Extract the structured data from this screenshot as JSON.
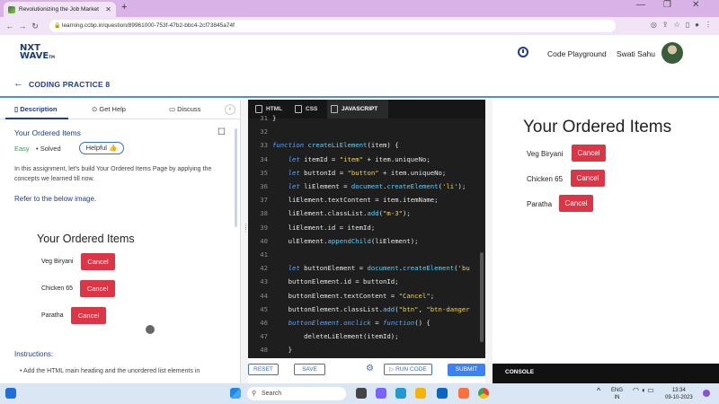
{
  "browser": {
    "tab_title": "Revolutionizing the Job Market",
    "url": "learning.ccbp.in/question/89961000-753f-47b2-bbc4-2cf73845a74f"
  },
  "header": {
    "logo_line1": "NXT",
    "logo_line2": "WAVE",
    "logo_tm": "TM",
    "code_playground": "Code Playground",
    "user_name": "Swati Sahu"
  },
  "practice": {
    "title": "CODING PRACTICE 8"
  },
  "left_panel": {
    "tabs": [
      "Description",
      "Get Help",
      "Discuss"
    ],
    "question_title": "Your Ordered Items",
    "difficulty": "Easy",
    "status": "Solved",
    "helpful_label": "Helpful",
    "description": "In this assignment, let's build Your Ordered Items Page by applying the concepts we learned till now.",
    "refer_text": "Refer to the below image.",
    "preview": {
      "title": "Your Ordered Items",
      "items": [
        {
          "name": "Veg Biryani",
          "button": "Cancel"
        },
        {
          "name": "Chicken 65",
          "button": "Cancel"
        },
        {
          "name": "Paratha",
          "button": "Cancel"
        }
      ]
    },
    "instructions_heading": "Instructions:",
    "instruction_1": "Add the HTML main heading and the unordered list elements in"
  },
  "editor": {
    "tabs": [
      "HTML",
      "CSS",
      "JAVASCRIPT"
    ],
    "active_tab": "JAVASCRIPT",
    "first_line_number": 31,
    "lines": [
      [
        {
          "t": "}"
        }
      ],
      [],
      [
        {
          "t": "function ",
          "c": "kw"
        },
        {
          "t": "createLiElement",
          "c": "fn"
        },
        {
          "t": "(item) {"
        }
      ],
      [
        {
          "t": "    let ",
          "c": "kw"
        },
        {
          "t": "itemId = "
        },
        {
          "t": "\"item\"",
          "c": "str"
        },
        {
          "t": " + item.uniqueNo;"
        }
      ],
      [
        {
          "t": "    let ",
          "c": "kw"
        },
        {
          "t": "buttonId = "
        },
        {
          "t": "\"button\"",
          "c": "str"
        },
        {
          "t": " + item.uniqueNo;"
        }
      ],
      [
        {
          "t": "    let ",
          "c": "kw"
        },
        {
          "t": "liElement = "
        },
        {
          "t": "document",
          "c": "fn"
        },
        {
          "t": "."
        },
        {
          "t": "createElement",
          "c": "fn"
        },
        {
          "t": "("
        },
        {
          "t": "'li'",
          "c": "str"
        },
        {
          "t": ");"
        }
      ],
      [
        {
          "t": "    liElement.textContent = item.itemName;"
        }
      ],
      [
        {
          "t": "    liElement.classList."
        },
        {
          "t": "add",
          "c": "fn"
        },
        {
          "t": "("
        },
        {
          "t": "\"m-3\"",
          "c": "str"
        },
        {
          "t": ");"
        }
      ],
      [
        {
          "t": "    liElement.id = itemId;"
        }
      ],
      [
        {
          "t": "    ulElement."
        },
        {
          "t": "appendChild",
          "c": "fn"
        },
        {
          "t": "(liElement);"
        }
      ],
      [],
      [
        {
          "t": "    let ",
          "c": "kw"
        },
        {
          "t": "buttonElement = "
        },
        {
          "t": "document",
          "c": "fn"
        },
        {
          "t": "."
        },
        {
          "t": "createElement",
          "c": "fn"
        },
        {
          "t": "("
        },
        {
          "t": "'bu",
          "c": "str"
        }
      ],
      [
        {
          "t": "    buttonElement.id = buttonId;"
        }
      ],
      [
        {
          "t": "    buttonElement.textContent = "
        },
        {
          "t": "\"Cancel\"",
          "c": "str"
        },
        {
          "t": ";"
        }
      ],
      [
        {
          "t": "    buttonElement.classList."
        },
        {
          "t": "add",
          "c": "fn"
        },
        {
          "t": "("
        },
        {
          "t": "\"btn\"",
          "c": "str"
        },
        {
          "t": ", "
        },
        {
          "t": "\"btn-danger",
          "c": "str"
        }
      ],
      [
        {
          "t": "    buttonElement.",
          "c": "kw"
        },
        {
          "t": "onclick",
          "c": "kw"
        },
        {
          "t": " = "
        },
        {
          "t": "function",
          "c": "kw"
        },
        {
          "t": "() {"
        }
      ],
      [
        {
          "t": "        deleteLiElement(itemId);"
        }
      ],
      [
        {
          "t": "    }"
        }
      ]
    ],
    "reset_label": "RESET",
    "save_label": "SAVE",
    "run_label": "RUN CODE",
    "submit_label": "SUBMIT"
  },
  "output": {
    "title": "Your Ordered Items",
    "items": [
      {
        "name": "Veg Biryani",
        "button": "Cancel"
      },
      {
        "name": "Chicken 65",
        "button": "Cancel"
      },
      {
        "name": "Paratha",
        "button": "Cancel"
      }
    ],
    "console_label": "CONSOLE"
  },
  "taskbar": {
    "search_placeholder": "Search",
    "lang_line1": "ENG",
    "lang_line2": "IN",
    "time": "13:34",
    "date": "09-10-2023"
  },
  "colors": {
    "brand": "#1e3d8f",
    "danger": "#dc3545",
    "submit": "#3b82f6"
  }
}
